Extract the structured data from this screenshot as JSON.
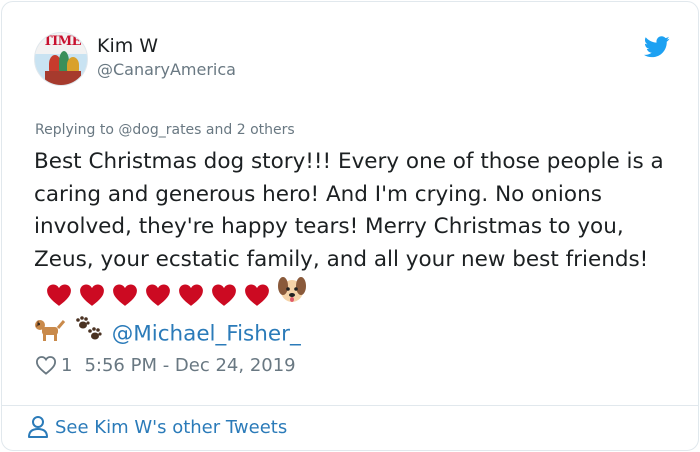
{
  "author": {
    "name": "Kim W",
    "handle": "@CanaryAmerica",
    "avatar_text": "TIME"
  },
  "reply_context": {
    "prefix": "Replying to",
    "mention": "@dog_rates",
    "suffix": "and 2 others"
  },
  "tweet": {
    "text": "Best Christmas dog story!!! Every one of those people is a caring and generous hero! And I'm crying. No onions involved, they're happy tears! Merry Christmas to you, Zeus, your ecstatic family, and all your new best friends!",
    "heart_count": 7,
    "mention": "@Michael_Fisher_"
  },
  "stats": {
    "likes": "1",
    "timestamp": "5:56 PM - Dec 24, 2019"
  },
  "footer": {
    "link_text": "See Kim W's other Tweets"
  },
  "icons": {
    "platform": "twitter-bird-icon",
    "like": "heart-outline-icon",
    "profile": "person-icon",
    "emoji": [
      "red-heart-icon",
      "dog-face-icon",
      "dog-icon",
      "paw-prints-icon"
    ]
  },
  "colors": {
    "link": "#2b7bb9",
    "muted": "#697882",
    "text": "#1c2022",
    "twitter_blue": "#1da1f2",
    "heart_red": "#cc0a22"
  }
}
